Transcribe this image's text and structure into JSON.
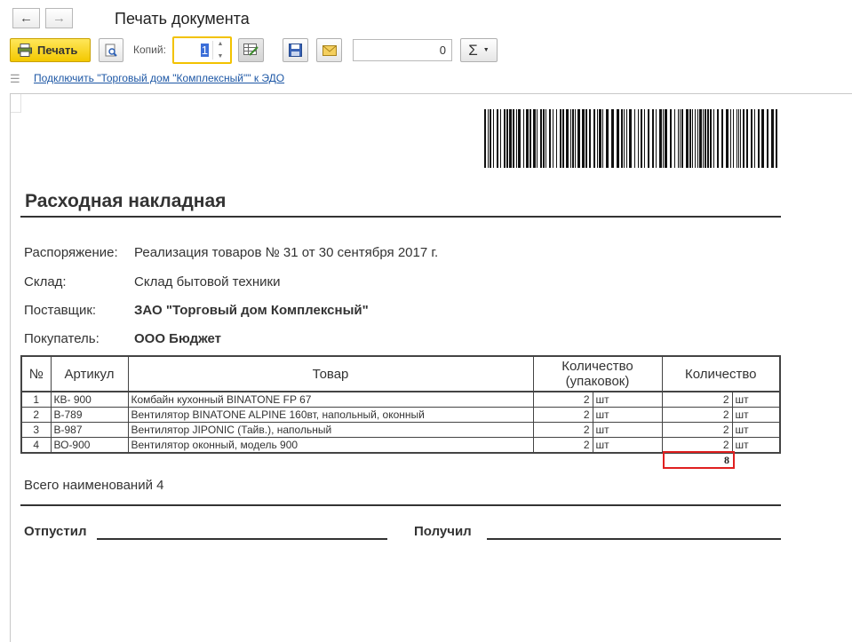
{
  "window": {
    "title": "Печать документа"
  },
  "toolbar": {
    "print_label": "Печать",
    "copies_label": "Копий:",
    "copies_value": "1",
    "counter_value": "0",
    "sum_symbol": "Σ"
  },
  "edo_link": "Подключить \"Торговый дом \"Комплексный\"\" к ЭДО",
  "doc": {
    "title": "Расходная накладная",
    "fields": {
      "order_label": "Распоряжение:",
      "order_value": "Реализация товаров № 31 от 30 сентября 2017 г.",
      "warehouse_label": "Склад:",
      "warehouse_value": "Склад бытовой техники",
      "supplier_label": "Поставщик:",
      "supplier_value": "ЗАО \"Торговый дом Комплексный\"",
      "buyer_label": "Покупатель:",
      "buyer_value": "ООО Бюджет"
    },
    "table": {
      "headers": {
        "num": "№",
        "article": "Артикул",
        "product": "Товар",
        "qty_pack_1": "Количество",
        "qty_pack_2": "(упаковок)",
        "qty": "Количество"
      },
      "rows": [
        {
          "num": "1",
          "article": "КВ- 900",
          "product": "Комбайн кухонный BINATONE FP 67",
          "qty_pack": "2",
          "unit_pack": "шт",
          "qty": "2",
          "unit": "шт"
        },
        {
          "num": "2",
          "article": "В-789",
          "product": "Вентилятор BINATONE ALPINE 160вт, напольный, оконный",
          "qty_pack": "2",
          "unit_pack": "шт",
          "qty": "2",
          "unit": "шт"
        },
        {
          "num": "3",
          "article": "В-987",
          "product": "Вентилятор JIPONIC (Тайв.), напольный",
          "qty_pack": "2",
          "unit_pack": "шт",
          "qty": "2",
          "unit": "шт"
        },
        {
          "num": "4",
          "article": "ВО-900",
          "product": "Вентилятор оконный, модель 900",
          "qty_pack": "2",
          "unit_pack": "шт",
          "qty": "2",
          "unit": "шт"
        }
      ],
      "total": "8"
    },
    "summary": "Всего наименований 4",
    "released_label": "Отпустил",
    "received_label": "Получил"
  }
}
